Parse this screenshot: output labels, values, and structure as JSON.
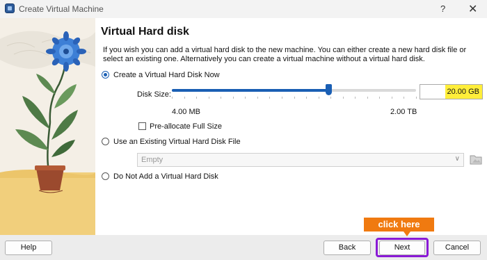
{
  "window": {
    "title": "Create Virtual Machine",
    "help_glyph": "?",
    "close_glyph": "✕"
  },
  "page": {
    "heading": "Virtual Hard disk",
    "description": "If you wish you can add a virtual hard disk to the new machine. You can either create a new hard disk file or select an existing one. Alternatively you can create a virtual machine without a virtual hard disk."
  },
  "options": {
    "create_new": {
      "label": "Create a Virtual Hard Disk Now",
      "selected": true
    },
    "use_existing": {
      "label": "Use an Existing Virtual Hard Disk File",
      "selected": false
    },
    "none": {
      "label": "Do Not Add a Virtual Hard Disk",
      "selected": false
    }
  },
  "disk_size": {
    "label": "Disk Size:",
    "value": "20.00 GB",
    "min_label": "4.00 MB",
    "max_label": "2.00 TB",
    "slider_fraction": 0.64
  },
  "preallocate": {
    "label": "Pre-allocate Full Size",
    "checked": false
  },
  "existing_file": {
    "selected": "Empty"
  },
  "buttons": {
    "help": "Help",
    "back": "Back",
    "next": "Next",
    "cancel": "Cancel"
  },
  "annotation": {
    "callout": "click here",
    "color": "#f07a10",
    "box_color": "#8a1ad6"
  },
  "colors": {
    "accent": "#1a5fb4",
    "size_highlight": "#ffee3a"
  }
}
